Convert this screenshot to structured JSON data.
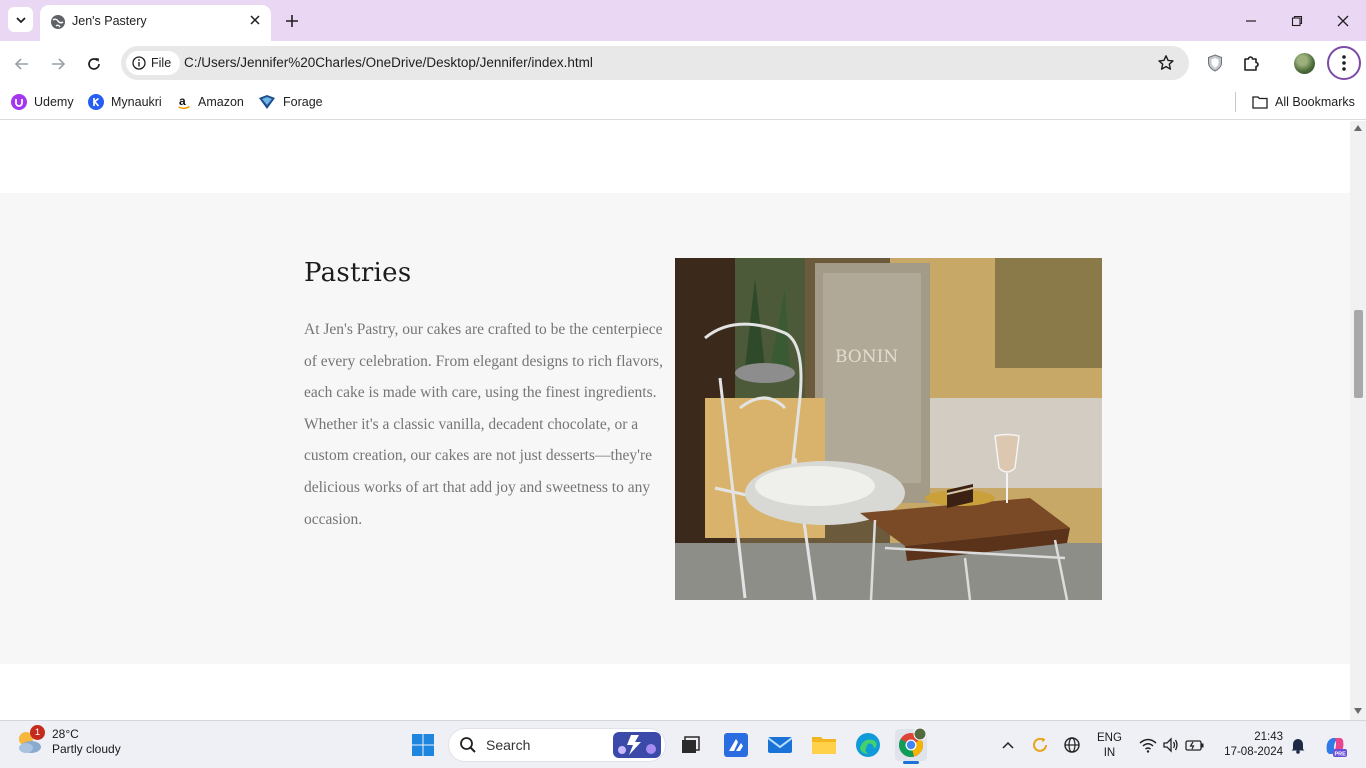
{
  "browser": {
    "tab_title": "Jen's Pastery",
    "site_info_label": "File",
    "url": "C:/Users/Jennifer%20Charles/OneDrive/Desktop/Jennifer/index.html",
    "bookmarks": [
      {
        "label": "Udemy",
        "icon": "udemy-icon"
      },
      {
        "label": "Mynaukri",
        "icon": "mynaukri-icon"
      },
      {
        "label": "Amazon",
        "icon": "amazon-icon"
      },
      {
        "label": "Forage",
        "icon": "forage-icon"
      }
    ],
    "all_bookmarks_label": "All Bookmarks"
  },
  "page": {
    "section": {
      "heading": "Pastries",
      "paragraph": "At Jen's Pastry, our cakes are crafted to be the centerpiece of every celebration. From elegant designs to rich flavors, each cake is made with care, using the finest ingredients. Whether it's a classic vanilla, decadent chocolate, or a custom creation, our cakes are not just desserts—they're delicious works of art that add joy and sweetness to any occasion.",
      "photo_sign_text": "BONIN"
    }
  },
  "taskbar": {
    "weather": {
      "temp": "28°C",
      "condition": "Partly cloudy",
      "badge": "1"
    },
    "search_placeholder": "Search",
    "lang_line1": "ENG",
    "lang_line2": "IN",
    "time": "21:43",
    "date": "17-08-2024"
  },
  "colors": {
    "tabstrip_bg": "#e9d7f4",
    "section_bg": "#f7f7f7",
    "paragraph_text": "#757575",
    "heading_text": "#1c1c1c",
    "menu_ring": "#7b4ba8"
  }
}
